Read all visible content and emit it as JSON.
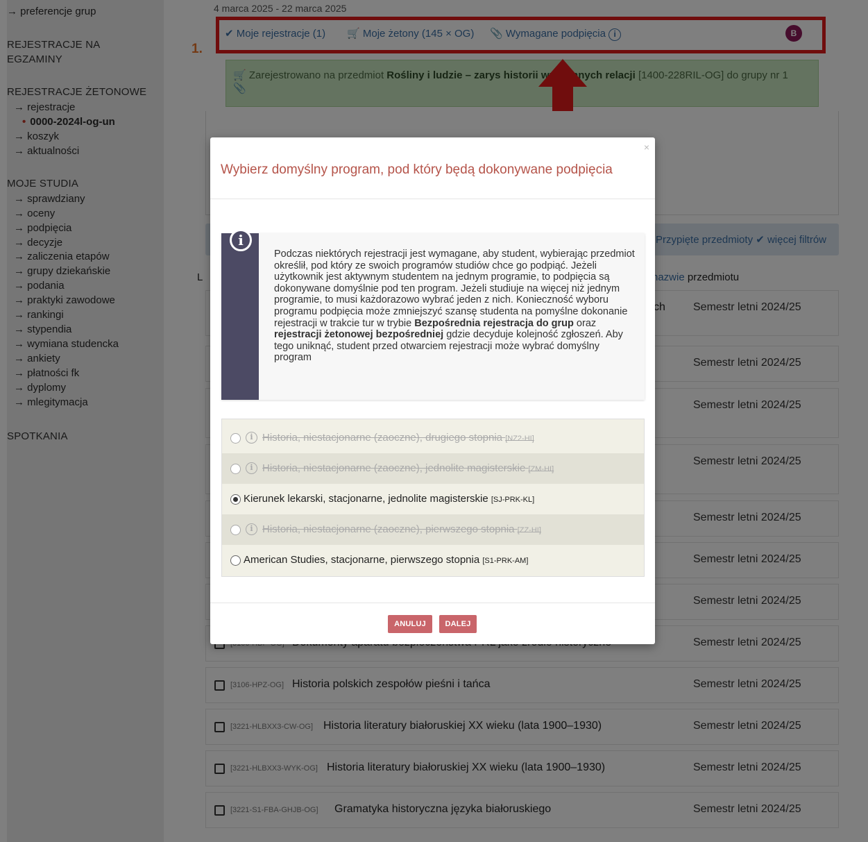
{
  "sidebar": {
    "items": [
      {
        "text": "preferencje grup",
        "kind": "link"
      },
      {
        "text": "REJESTRACJE NA",
        "kind": "section"
      },
      {
        "text": "EGZAMINY",
        "kind": "section"
      },
      {
        "text": "REJESTRACJE ŻETONOWE",
        "kind": "section"
      },
      {
        "text": "rejestracje",
        "kind": "link"
      },
      {
        "text": "0000-2024l-og-un",
        "kind": "current"
      },
      {
        "text": "koszyk",
        "kind": "link"
      },
      {
        "text": "aktualności",
        "kind": "link"
      },
      {
        "text": "MOJE STUDIA",
        "kind": "section"
      },
      {
        "text": "sprawdziany",
        "kind": "link"
      },
      {
        "text": "oceny",
        "kind": "link"
      },
      {
        "text": "podpięcia",
        "kind": "link"
      },
      {
        "text": "decyzje",
        "kind": "link"
      },
      {
        "text": "zaliczenia etapów",
        "kind": "link"
      },
      {
        "text": "grupy dziekańskie",
        "kind": "link"
      },
      {
        "text": "podania",
        "kind": "link"
      },
      {
        "text": "praktyki zawodowe",
        "kind": "link"
      },
      {
        "text": "rankingi",
        "kind": "link"
      },
      {
        "text": "stypendia",
        "kind": "link"
      },
      {
        "text": "wymiana studencka",
        "kind": "link"
      },
      {
        "text": "ankiety",
        "kind": "link"
      },
      {
        "text": "płatności fk",
        "kind": "link"
      },
      {
        "text": "dyplomy",
        "kind": "link"
      },
      {
        "text": "mlegitymacja",
        "kind": "link"
      },
      {
        "text": "SPOTKANIA",
        "kind": "section"
      }
    ]
  },
  "header": {
    "date_range": "4 marca 2025 - 22 marca 2025",
    "tab_registrations": "Moje rejestracje (1)",
    "tab_tokens": "Moje żetony (145 × OG)",
    "tab_required": "Wymagane podpięcia",
    "avatar": "B",
    "step_label": "1."
  },
  "success": {
    "prefix": "Zarejestrowano na przedmiot",
    "course": "Rośliny i ludzie – zarys historii wzajemnych relacji",
    "suffix": "[1400-228RIL-OG] do grupy nr 1"
  },
  "filters": {
    "text": "Przypięte przedmioty ✔ więcej filtrów"
  },
  "sort": {
    "letter": "L",
    "prefix": "nazwie",
    "suffix": "przedmiotu"
  },
  "rows": [
    {
      "code": "",
      "title": "",
      "semester": "Semestr letni 2024/25",
      "partial": "ch"
    },
    {
      "code": "",
      "title": "",
      "semester": "Semestr letni 2024/25"
    },
    {
      "code": "",
      "title": "",
      "semester": "Semestr letni 2024/25"
    },
    {
      "code": "",
      "title": "",
      "semester": "Semestr letni 2024/25"
    },
    {
      "code": "",
      "title": "",
      "semester": "Semestr letni 2024/25"
    },
    {
      "code": "",
      "title": "",
      "semester": "Semestr letni 2024/25"
    },
    {
      "code": "",
      "title": "",
      "semester": "Semestr letni 2024/25"
    },
    {
      "code": "[3106-HBP-OG]",
      "title": "Dokumenty aparatu bezpieczeństwa PRL jako źródło historyczne",
      "semester": "Semestr letni 2024/25"
    },
    {
      "code": "[3106-HPZ-OG]",
      "title": "Historia polskich zespołów pieśni i tańca",
      "semester": "Semestr letni 2024/25"
    },
    {
      "code": "[3221-HLBXX3-CW-OG]",
      "title": "Historia literatury białoruskiej XX wieku (lata 1900–1930)",
      "semester": "Semestr letni 2024/25"
    },
    {
      "code": "[3221-HLBXX3-WYK-OG]",
      "title": "Historia literatury białoruskiej XX wieku (lata 1900–1930)",
      "semester": "Semestr letni 2024/25"
    },
    {
      "code": "[3221-S1-FBA-GHJB-OG]",
      "title": "Gramatyka historyczna języka białoruskiego",
      "semester": "Semestr letni 2024/25"
    }
  ],
  "modal": {
    "close": "×",
    "title": "Wybierz domyślny program, pod który będą dokonywane podpięcia",
    "info_text_1": "Podczas niektórych rejestracji jest wymagane, aby student, wybierając przedmiot określił, pod który ze swoich programów studiów chce go podpiąć. Jeżeli użytkownik jest aktywnym studentem na jednym programie, to podpięcia są dokonywane domyślnie pod ten program. Jeżeli studiuje na więcej niż jednym programie, to musi każdorazowo wybrać jeden z nich. Konieczność wyboru programu podpięcia może zmniejszyć szansę studenta na pomyślne dokonanie rejestracji w trakcie tur w trybie ",
    "info_bold_1": "Bezpośrednia rejestracja do grup",
    "info_text_2": " oraz ",
    "info_bold_2": "rejestracji żetonowej bezpośredniej",
    "info_text_3": " gdzie decyduje kolejność zgłoszeń. Aby tego uniknąć, student przed otwarciem rejestracji może wybrać domyślny program",
    "options": [
      {
        "label": "Historia, niestacjonarne (zaoczne), drugiego stopnia",
        "code": "[NZ2-HI]",
        "disabled": true,
        "selected": false
      },
      {
        "label": "Historia, niestacjonarne (zaoczne), jednolite magisterskie",
        "code": "[ZM-HI]",
        "disabled": true,
        "selected": false
      },
      {
        "label": "Kierunek lekarski, stacjonarne, jednolite magisterskie",
        "code": "[SJ-PRK-KL]",
        "disabled": false,
        "selected": true
      },
      {
        "label": "Historia, niestacjonarne (zaoczne), pierwszego stopnia",
        "code": "[ZZ-HI]",
        "disabled": true,
        "selected": false
      },
      {
        "label": "American Studies, stacjonarne, pierwszego stopnia",
        "code": "[S1-PRK-AM]",
        "disabled": false,
        "selected": false
      }
    ],
    "cancel": "ANULUJ",
    "next": "DALEJ"
  },
  "colors": {
    "highlight_box": "#e01a1a",
    "arrow": "#e01a1a",
    "modal_title": "#b5544a",
    "buttons": "#c9656a",
    "success_bg": "#c9e6c1",
    "info_band": "#4c4a64"
  }
}
